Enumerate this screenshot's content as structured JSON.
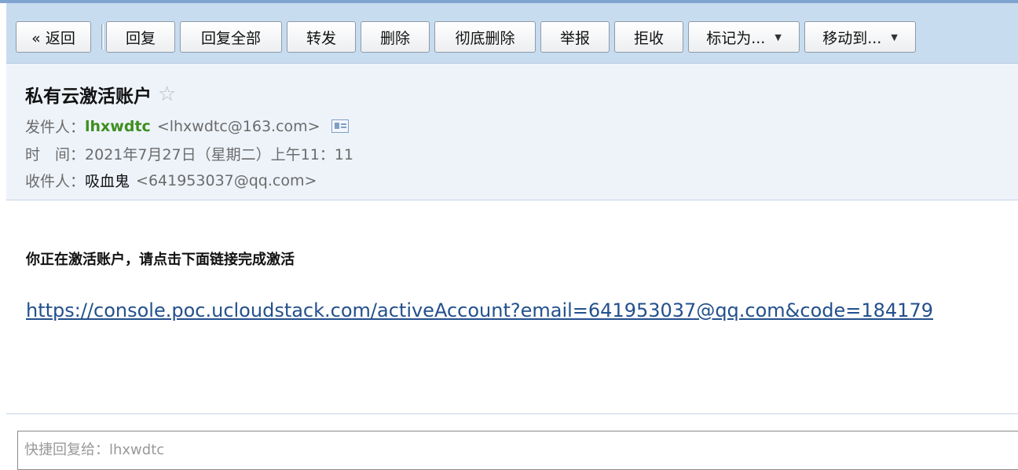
{
  "toolbar": {
    "back_label": "« 返回",
    "reply_label": "回复",
    "reply_all_label": "回复全部",
    "forward_label": "转发",
    "delete_label": "删除",
    "delete_permanent_label": "彻底删除",
    "report_label": "举报",
    "reject_label": "拒收",
    "mark_as_label": "标记为...",
    "move_to_label": "移动到..."
  },
  "email": {
    "subject": "私有云激活账户",
    "from_label": "发件人：",
    "from_name": "lhxwdtc",
    "from_address": "<lhxwdtc@163.com>",
    "time_label": "时　间：",
    "time_value": "2021年7月27日（星期二）上午11：11",
    "to_label": "收件人：",
    "to_name": "吸血鬼",
    "to_address": "<641953037@qq.com>"
  },
  "body": {
    "text": "你正在激活账户，请点击下面链接完成激活",
    "link": "https://console.poc.ucloudstack.com/activeAccount?email=641953037@qq.com&code=184179"
  },
  "quick_reply": {
    "placeholder": "快捷回复给：lhxwdtc"
  },
  "icons": {
    "star": "star-outline-icon",
    "contact_card": "contact-card-icon",
    "dropdown": "triangle-down-icon"
  },
  "colors": {
    "toolbar_bg": "#c8dcf0",
    "header_bg": "#eef3fa",
    "sender_name": "#3d8f1f",
    "link": "#23508c"
  }
}
